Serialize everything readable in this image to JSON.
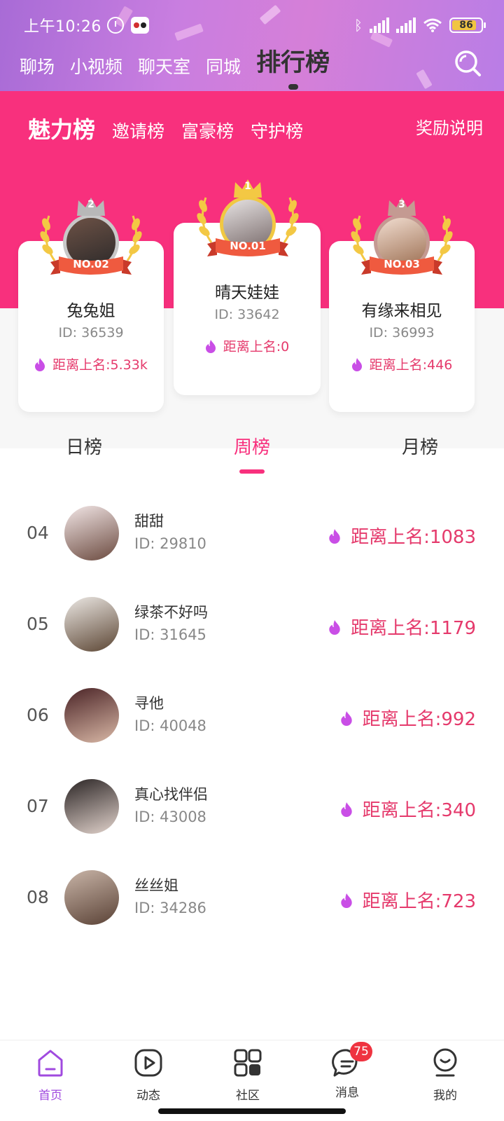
{
  "status": {
    "time": "上午10:26",
    "battery": "86"
  },
  "top_nav": [
    {
      "label": "聊场"
    },
    {
      "label": "小视频"
    },
    {
      "label": "聊天室"
    },
    {
      "label": "同城"
    },
    {
      "label": "排行榜"
    }
  ],
  "sub_tabs": [
    {
      "label": "魅力榜"
    },
    {
      "label": "邀请榜"
    },
    {
      "label": "富豪榜"
    },
    {
      "label": "守护榜"
    }
  ],
  "reward_link": "奖励说明",
  "podium": {
    "second": {
      "rank_num": "2",
      "badge": "NO.02",
      "name": "兔兔姐",
      "id": "ID: 36539",
      "gap": "距离上名:5.33k"
    },
    "first": {
      "rank_num": "1",
      "badge": "NO.01",
      "name": "晴天娃娃",
      "id": "ID: 33642",
      "gap": "距离上名:0"
    },
    "third": {
      "rank_num": "3",
      "badge": "NO.03",
      "name": "有缘来相见",
      "id": "ID: 36993",
      "gap": "距离上名:446"
    }
  },
  "period_tabs": [
    {
      "label": "日榜"
    },
    {
      "label": "周榜"
    },
    {
      "label": "月榜"
    }
  ],
  "ranking": [
    {
      "rank": "04",
      "name": "甜甜",
      "id": "ID: 29810",
      "gap": "距离上名:1083"
    },
    {
      "rank": "05",
      "name": "绿茶不好吗",
      "id": "ID: 31645",
      "gap": "距离上名:1179"
    },
    {
      "rank": "06",
      "name": "寻他",
      "id": "ID: 40048",
      "gap": "距离上名:992"
    },
    {
      "rank": "07",
      "name": "真心找伴侣",
      "id": "ID: 43008",
      "gap": "距离上名:340"
    },
    {
      "rank": "08",
      "name": "丝丝姐",
      "id": "ID: 34286",
      "gap": "距离上名:723"
    }
  ],
  "bottom_nav": [
    {
      "label": "首页",
      "icon": "home-icon"
    },
    {
      "label": "动态",
      "icon": "play-icon"
    },
    {
      "label": "社区",
      "icon": "grid-icon"
    },
    {
      "label": "消息",
      "icon": "message-icon",
      "badge": "75"
    },
    {
      "label": "我的",
      "icon": "profile-icon"
    }
  ],
  "colors": {
    "accent": "#f8307d",
    "active_nav": "#a04adf",
    "gap_text": "#e53a6c"
  }
}
